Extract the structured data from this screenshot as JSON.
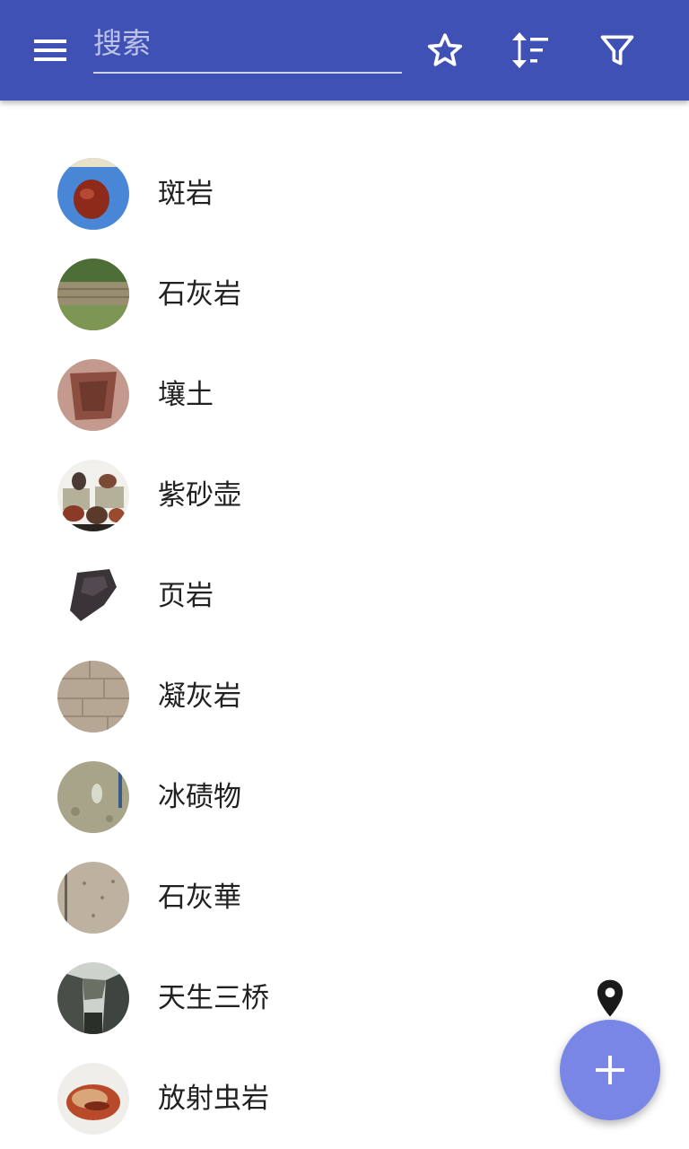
{
  "toolbar": {
    "search_placeholder": "搜索",
    "search_value": "",
    "menu_icon": "menu-icon",
    "favorites_icon": "star-icon",
    "sort_icon": "sort-icon",
    "filter_icon": "filter-icon",
    "background_color": "#3f51b5"
  },
  "items": [
    {
      "label": "斑岩",
      "thumbnail": "polished red-brown stone on blue background"
    },
    {
      "label": "石灰岩",
      "thumbnail": "limestone wall with grass"
    },
    {
      "label": "壤土",
      "thumbnail": "soil pit"
    },
    {
      "label": "紫砂壶",
      "thumbnail": "clay teapots"
    },
    {
      "label": "页岩",
      "thumbnail": "dark shale fragment"
    },
    {
      "label": "凝灰岩",
      "thumbnail": "tuff stone wall"
    },
    {
      "label": "冰碛物",
      "thumbnail": "glacial till with pen"
    },
    {
      "label": "石灰華",
      "thumbnail": "travertine surface"
    },
    {
      "label": "天生三桥",
      "thumbnail": "karst natural bridge"
    },
    {
      "label": "放射虫岩",
      "thumbnail": "banded radiolarite pebble"
    }
  ],
  "map_marker_icon": "location-pin-icon",
  "fab": {
    "icon": "plus-icon",
    "color": "#7986e6"
  }
}
